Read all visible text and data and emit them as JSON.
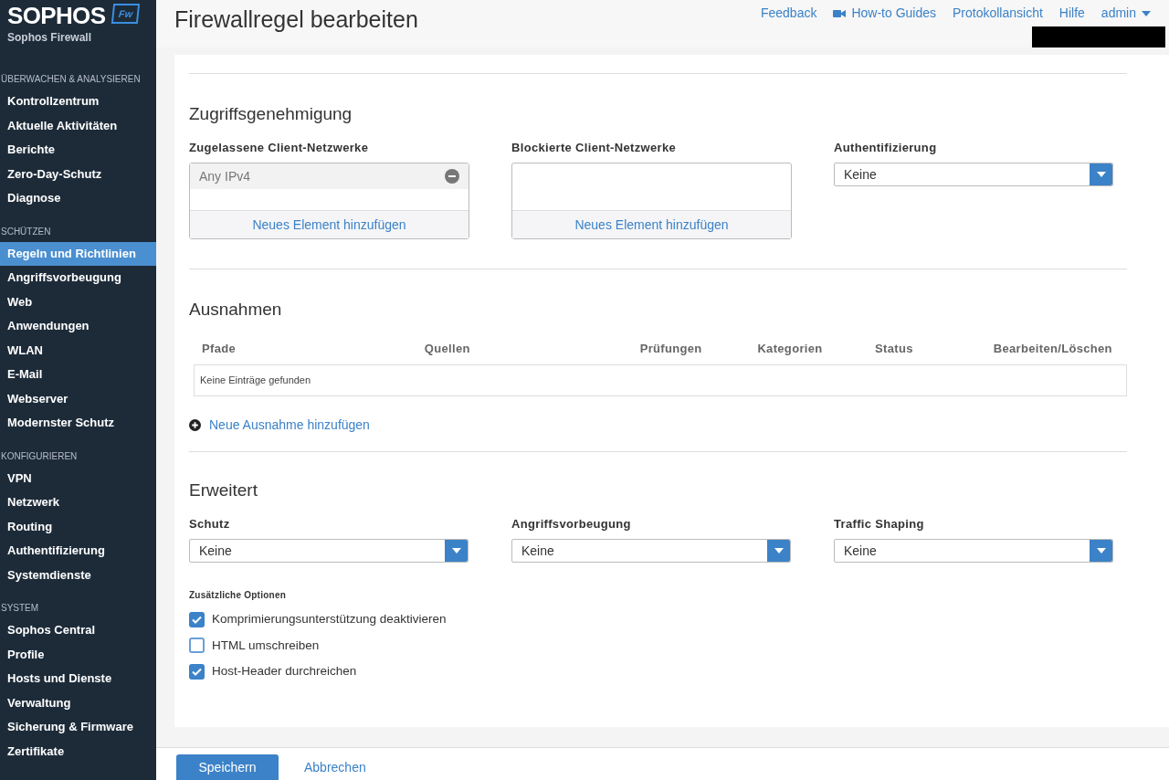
{
  "brand": {
    "logo": "SOPHOS",
    "badge": "Fw",
    "product": "Sophos Firewall"
  },
  "sidebar": {
    "sections": [
      {
        "heading": "ÜBERWACHEN & ANALYSIEREN",
        "items": [
          {
            "label": "Kontrollzentrum",
            "selected": false
          },
          {
            "label": "Aktuelle Aktivitäten",
            "selected": false
          },
          {
            "label": "Berichte",
            "selected": false
          },
          {
            "label": "Zero-Day-Schutz",
            "selected": false
          },
          {
            "label": "Diagnose",
            "selected": false
          }
        ]
      },
      {
        "heading": "SCHÜTZEN",
        "items": [
          {
            "label": "Regeln und Richtlinien",
            "selected": true
          },
          {
            "label": "Angriffsvorbeugung",
            "selected": false
          },
          {
            "label": "Web",
            "selected": false
          },
          {
            "label": "Anwendungen",
            "selected": false
          },
          {
            "label": "WLAN",
            "selected": false
          },
          {
            "label": "E-Mail",
            "selected": false
          },
          {
            "label": "Webserver",
            "selected": false
          },
          {
            "label": "Modernster Schutz",
            "selected": false
          }
        ]
      },
      {
        "heading": "KONFIGURIEREN",
        "items": [
          {
            "label": "VPN",
            "selected": false
          },
          {
            "label": "Netzwerk",
            "selected": false
          },
          {
            "label": "Routing",
            "selected": false
          },
          {
            "label": "Authentifizierung",
            "selected": false
          },
          {
            "label": "Systemdienste",
            "selected": false
          }
        ]
      },
      {
        "heading": "SYSTEM",
        "items": [
          {
            "label": "Sophos Central",
            "selected": false
          },
          {
            "label": "Profile",
            "selected": false
          },
          {
            "label": "Hosts und Dienste",
            "selected": false
          },
          {
            "label": "Verwaltung",
            "selected": false
          },
          {
            "label": "Sicherung & Firmware",
            "selected": false
          },
          {
            "label": "Zertifikate",
            "selected": false
          }
        ]
      }
    ]
  },
  "header": {
    "title": "Firewallregel bearbeiten",
    "links": [
      {
        "label": "Feedback",
        "kind": "plain"
      },
      {
        "label": "How-to Guides",
        "kind": "video"
      },
      {
        "label": "Protokollansicht",
        "kind": "plain"
      },
      {
        "label": "Hilfe",
        "kind": "plain"
      },
      {
        "label": "admin",
        "kind": "menu"
      }
    ]
  },
  "access": {
    "title": "Zugriffsgenehmigung",
    "lists": [
      {
        "label": "Zugelassene Client-Netzwerke",
        "entries": [
          "Any IPv4"
        ],
        "add": "Neues Element hinzufügen"
      },
      {
        "label": "Blockierte Client-Netzwerke",
        "add": "Neues Element hinzufügen"
      }
    ],
    "auth": {
      "label": "Authentifizierung",
      "value": "Keine"
    }
  },
  "exceptions": {
    "title": "Ausnahmen",
    "columns": [
      "Pfade",
      "Quellen",
      "Prüfungen",
      "Kategorien",
      "Status",
      "Bearbeiten/Löschen"
    ],
    "empty": "Keine Einträge gefunden",
    "add": "Neue Ausnahme hinzufügen"
  },
  "advanced": {
    "title": "Erweitert",
    "selects": [
      {
        "label": "Schutz",
        "value": "Keine"
      },
      {
        "label": "Angriffsvorbeugung",
        "value": "Keine"
      },
      {
        "label": "Traffic Shaping",
        "value": "Keine"
      }
    ],
    "options_label": "Zusätzliche Optionen",
    "options": [
      {
        "label": "Komprimierungsunterstützung deaktivieren",
        "checked": true
      },
      {
        "label": "HTML umschreiben",
        "checked": false
      },
      {
        "label": "Host-Header durchreichen",
        "checked": true
      }
    ]
  },
  "footer": {
    "save": "Speichern",
    "cancel": "Abbrechen"
  }
}
